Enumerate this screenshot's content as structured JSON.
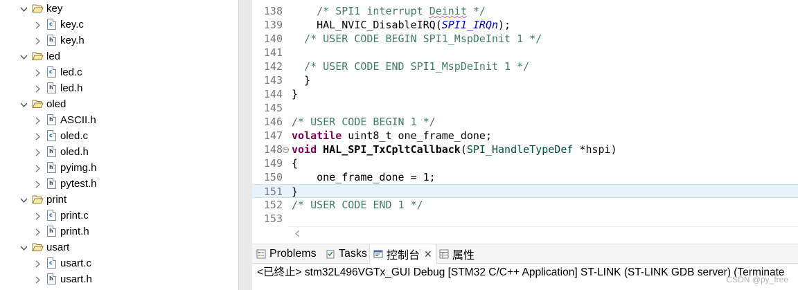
{
  "explorer": {
    "rows": [
      {
        "type": "folder",
        "label": "key"
      },
      {
        "type": "file",
        "ext": "c",
        "label": "key.c"
      },
      {
        "type": "file",
        "ext": "h",
        "label": "key.h"
      },
      {
        "type": "folder",
        "label": "led"
      },
      {
        "type": "file",
        "ext": "c",
        "label": "led.c"
      },
      {
        "type": "file",
        "ext": "h",
        "label": "led.h"
      },
      {
        "type": "folder",
        "label": "oled"
      },
      {
        "type": "file",
        "ext": "h",
        "label": "ASCII.h"
      },
      {
        "type": "file",
        "ext": "c",
        "label": "oled.c"
      },
      {
        "type": "file",
        "ext": "h",
        "label": "oled.h"
      },
      {
        "type": "file",
        "ext": "h",
        "label": "pyimg.h"
      },
      {
        "type": "file",
        "ext": "h",
        "label": "pytest.h"
      },
      {
        "type": "folder",
        "label": "print"
      },
      {
        "type": "file",
        "ext": "c",
        "label": "print.c"
      },
      {
        "type": "file",
        "ext": "h",
        "label": "print.h"
      },
      {
        "type": "folder",
        "label": "usart"
      },
      {
        "type": "file",
        "ext": "c",
        "label": "usart.c"
      },
      {
        "type": "file",
        "ext": "h",
        "label": "usart.h"
      }
    ]
  },
  "editor": {
    "lines": [
      {
        "n": "138",
        "segs": [
          {
            "t": "    "
          },
          {
            "t": "/* SPI1 interrupt ",
            "c": "cm"
          },
          {
            "t": "Deinit",
            "c": "cm squiggle"
          },
          {
            "t": " */",
            "c": "cm"
          }
        ]
      },
      {
        "n": "139",
        "segs": [
          {
            "t": "    HAL_NVIC_DisableIRQ("
          },
          {
            "t": "SPI1_IRQn",
            "c": "mac"
          },
          {
            "t": ");"
          }
        ]
      },
      {
        "n": "140",
        "segs": [
          {
            "t": "  "
          },
          {
            "t": "/* USER CODE BEGIN SPI1_MspDeInit 1 */",
            "c": "cm"
          }
        ]
      },
      {
        "n": "141",
        "segs": []
      },
      {
        "n": "142",
        "segs": [
          {
            "t": "  "
          },
          {
            "t": "/* USER CODE END SPI1_MspDeInit 1 */",
            "c": "cm"
          }
        ]
      },
      {
        "n": "143",
        "segs": [
          {
            "t": "  }"
          }
        ]
      },
      {
        "n": "144",
        "segs": [
          {
            "t": "}"
          }
        ]
      },
      {
        "n": "145",
        "segs": []
      },
      {
        "n": "146",
        "segs": [
          {
            "t": "/* USER CODE BEGIN 1 */",
            "c": "cm"
          }
        ]
      },
      {
        "n": "147",
        "segs": [
          {
            "t": "volatile",
            "c": "kw"
          },
          {
            "t": " uint8_t one_frame_done;"
          }
        ]
      },
      {
        "n": "148",
        "fold": true,
        "segs": [
          {
            "t": "void",
            "c": "kw"
          },
          {
            "t": " "
          },
          {
            "t": "HAL_SPI_TxCpltCallback",
            "c": "fn"
          },
          {
            "t": "("
          },
          {
            "t": "SPI_HandleTypeDef",
            "c": "typ"
          },
          {
            "t": " *hspi)"
          }
        ]
      },
      {
        "n": "149",
        "segs": [
          {
            "t": "{"
          }
        ]
      },
      {
        "n": "150",
        "segs": [
          {
            "t": "    one_frame_done = 1;"
          }
        ]
      },
      {
        "n": "151",
        "current": true,
        "segs": [
          {
            "t": "}"
          }
        ]
      },
      {
        "n": "152",
        "segs": [
          {
            "t": "/* USER CODE END 1 */",
            "c": "cm"
          }
        ]
      },
      {
        "n": "153",
        "segs": []
      }
    ]
  },
  "views": {
    "tabs": [
      {
        "label": "Problems",
        "icon": "problems-icon"
      },
      {
        "label": "Tasks",
        "icon": "tasks-icon"
      },
      {
        "label": "控制台",
        "icon": "console-icon",
        "active": true,
        "close": "✕"
      },
      {
        "label": "属性",
        "icon": "properties-icon"
      }
    ],
    "console_line": "<已终止> stm32L496VGTx_GUI Debug [STM32 C/C++ Application] ST-LINK (ST-LINK GDB server) (Terminate",
    "watermark": "CSDN @py_free"
  },
  "colors": {
    "comment": "#3f7f5f",
    "keyword": "#7f0055",
    "macro": "#0000c0",
    "type": "#005032",
    "current_line": "#e8f2fe"
  }
}
